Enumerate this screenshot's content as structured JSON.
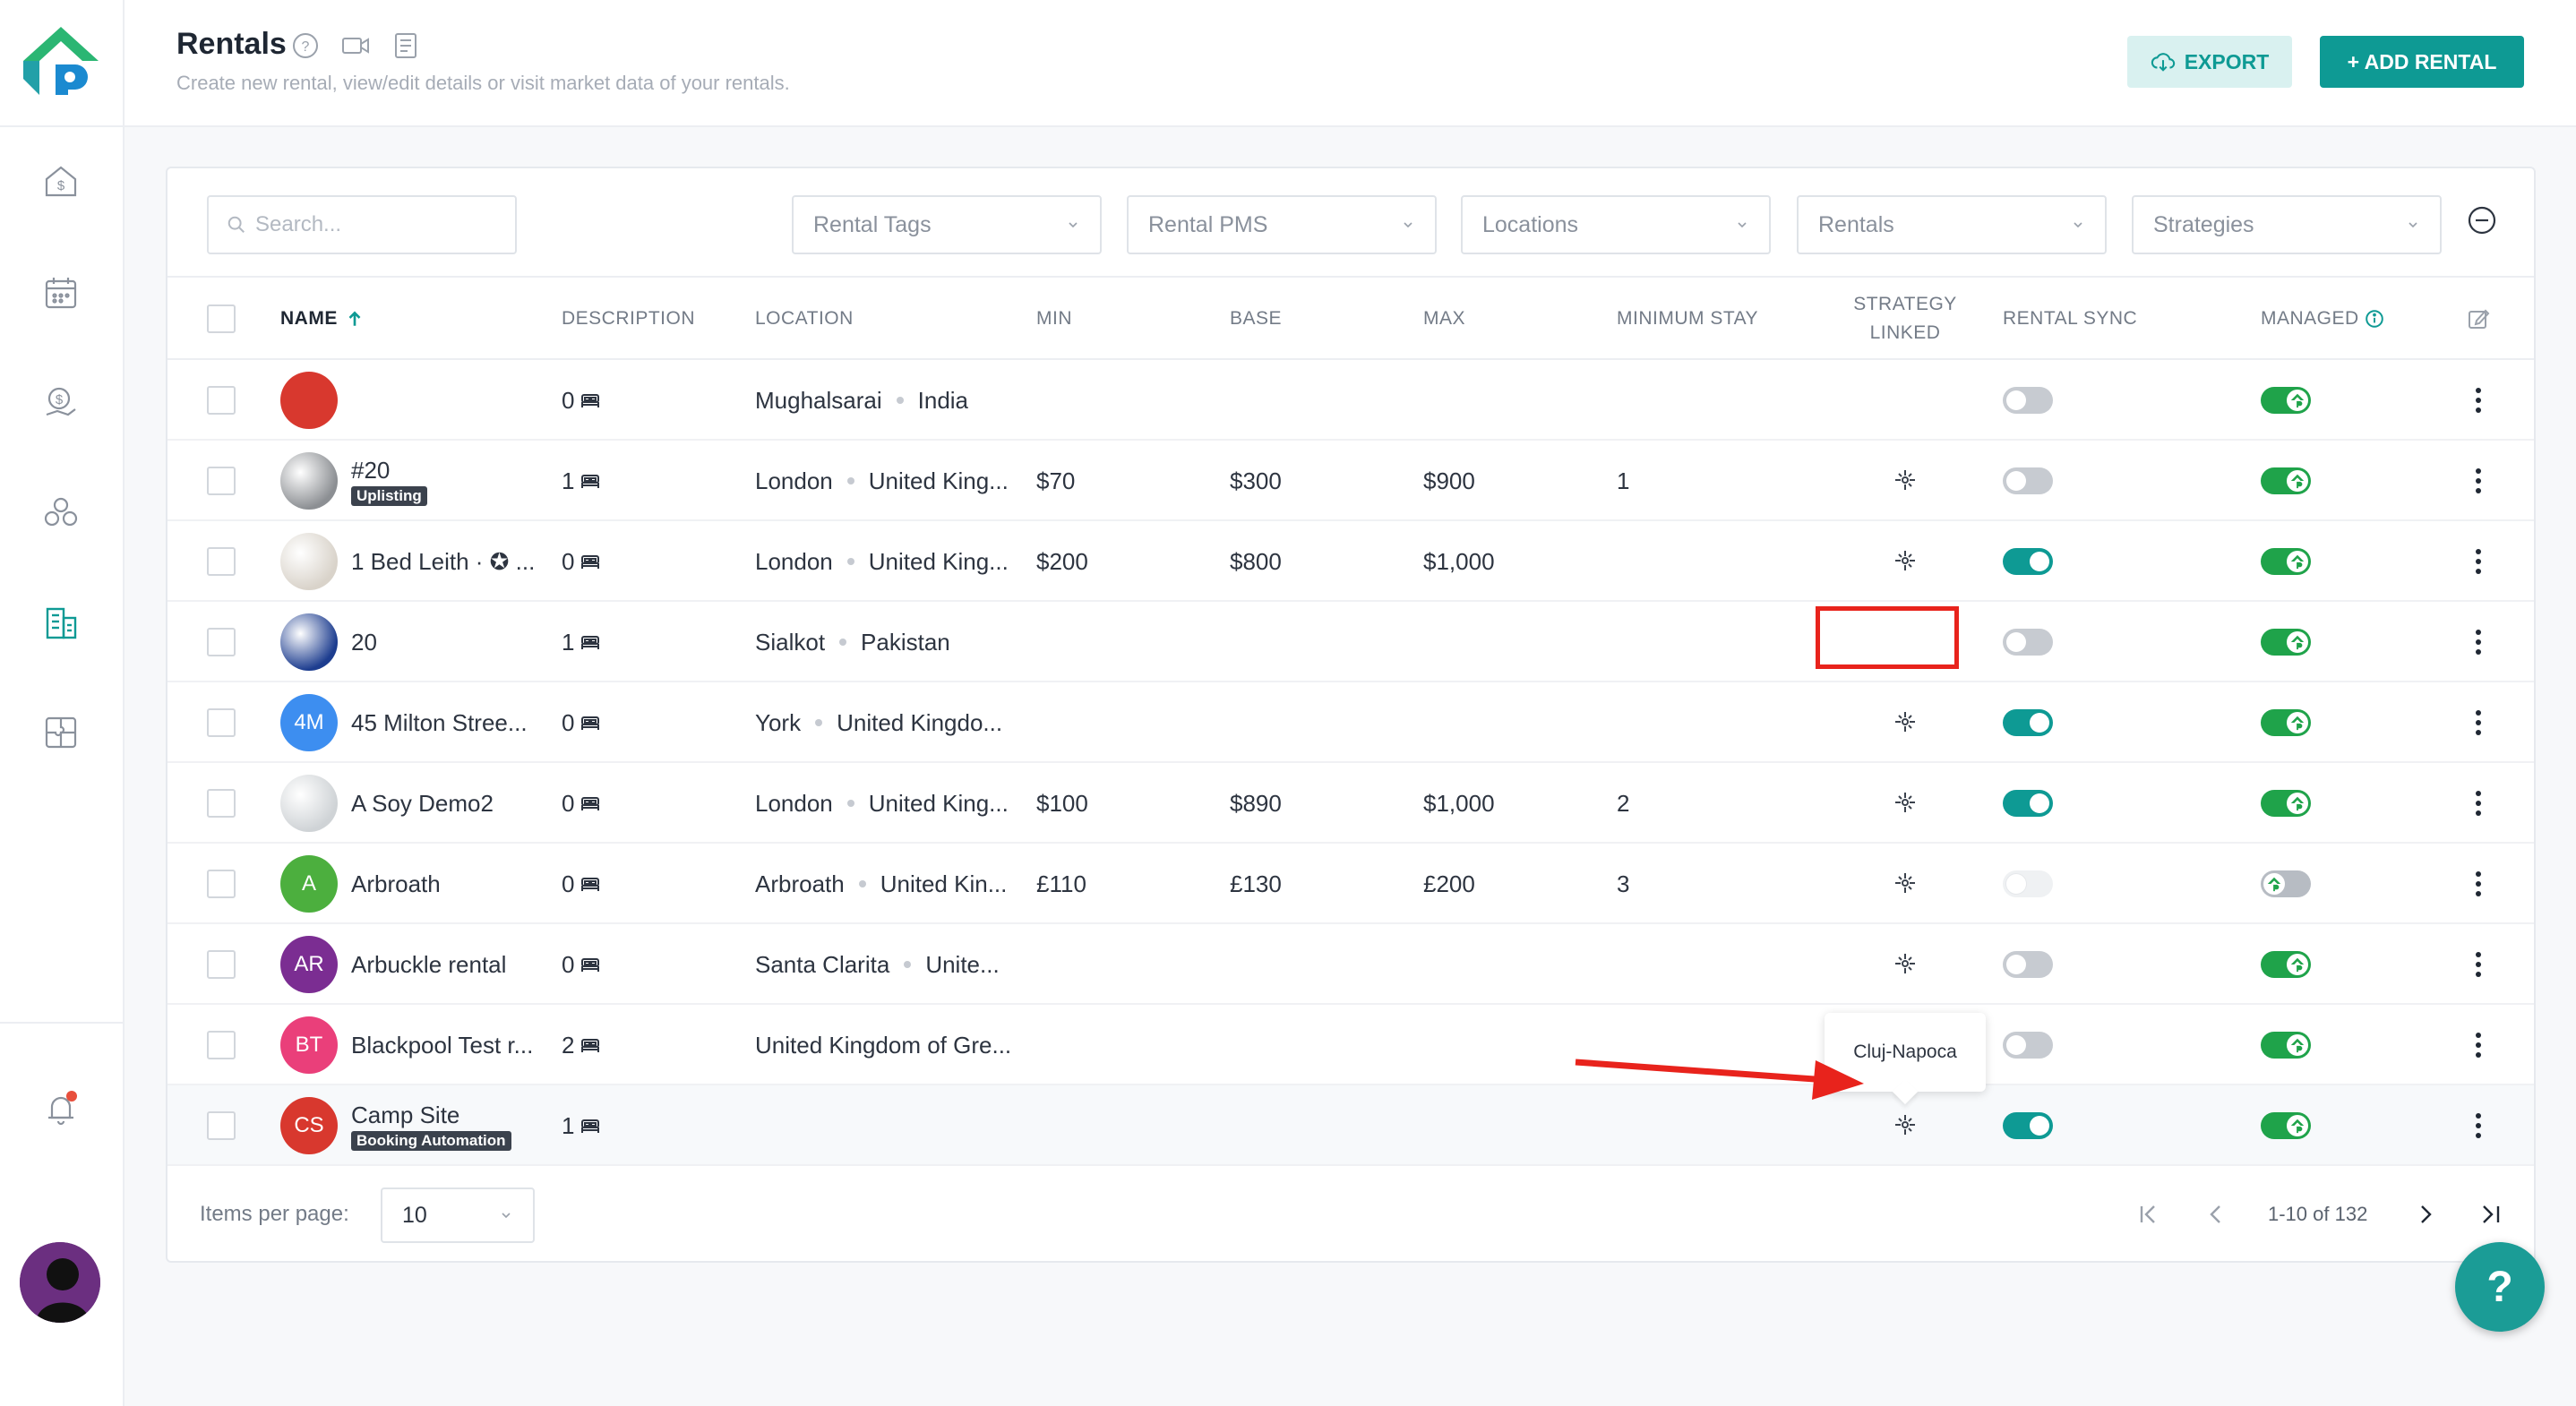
{
  "header": {
    "title": "Rentals",
    "subtitle": "Create new rental, view/edit details or visit market data of your rentals.",
    "export_label": "EXPORT",
    "add_label": "+ ADD RENTAL"
  },
  "sidebar": {
    "items": [
      "dashboard-icon",
      "calendar-icon",
      "pricing-icon",
      "market-icon",
      "rentals-icon",
      "puzzle-icon"
    ],
    "active": "rentals-icon"
  },
  "filters": {
    "search_placeholder": "Search...",
    "dropdowns": [
      "Rental Tags",
      "Rental PMS",
      "Locations",
      "Rentals",
      "Strategies"
    ]
  },
  "columns": {
    "name": "NAME",
    "description": "DESCRIPTION",
    "location": "LOCATION",
    "min": "MIN",
    "base": "BASE",
    "max": "MAX",
    "minimum_stay": "MINIMUM STAY",
    "strategy_linked_1": "STRATEGY",
    "strategy_linked_2": "LINKED",
    "rental_sync": "RENTAL SYNC",
    "managed": "MANAGED"
  },
  "rows": [
    {
      "name": "",
      "tag": "",
      "initials": "",
      "avatar_color": "#d8382e",
      "bedrooms": "0",
      "city": "Mughalsarai",
      "country": "India",
      "min": "",
      "base": "",
      "max": "",
      "min_stay": "",
      "strategy": false,
      "sync": "off",
      "managed": "on"
    },
    {
      "name": "#20",
      "tag": "Uplisting",
      "initials": "",
      "avatar_color": "#8c8f93",
      "bedrooms": "1",
      "city": "London",
      "country": "United King...",
      "min": "$70",
      "base": "$300",
      "max": "$900",
      "min_stay": "1",
      "strategy": true,
      "sync": "off",
      "managed": "on"
    },
    {
      "name": "1 Bed Leith · ✪ ...",
      "tag": "",
      "initials": "",
      "avatar_color": "#d9d3ca",
      "bedrooms": "0",
      "city": "London",
      "country": "United King...",
      "min": "$200",
      "base": "$800",
      "max": "$1,000",
      "min_stay": "",
      "strategy": true,
      "sync": "on",
      "managed": "on"
    },
    {
      "name": "20",
      "tag": "",
      "initials": "",
      "avatar_color": "#1d3d8f",
      "bedrooms": "1",
      "city": "Sialkot",
      "country": "Pakistan",
      "min": "",
      "base": "",
      "max": "",
      "min_stay": "",
      "strategy": false,
      "sync": "off",
      "managed": "on"
    },
    {
      "name": "45 Milton Stree...",
      "tag": "",
      "initials": "4M",
      "avatar_color": "#3d8ef0",
      "bedrooms": "0",
      "city": "York",
      "country": "United Kingdo...",
      "min": "",
      "base": "",
      "max": "",
      "min_stay": "",
      "strategy": true,
      "sync": "on",
      "managed": "on"
    },
    {
      "name": "A Soy Demo2",
      "tag": "",
      "initials": "",
      "avatar_color": "#cfd3d6",
      "bedrooms": "0",
      "city": "London",
      "country": "United King...",
      "min": "$100",
      "base": "$890",
      "max": "$1,000",
      "min_stay": "2",
      "strategy": true,
      "sync": "on",
      "managed": "on"
    },
    {
      "name": "Arbroath",
      "tag": "",
      "initials": "A",
      "avatar_color": "#4caf3e",
      "bedrooms": "0",
      "city": "Arbroath",
      "country": "United Kin...",
      "min": "£110",
      "base": "£130",
      "max": "£200",
      "min_stay": "3",
      "strategy": true,
      "sync": "disabled",
      "managed": "off"
    },
    {
      "name": "Arbuckle rental",
      "tag": "",
      "initials": "AR",
      "avatar_color": "#7b2d92",
      "bedrooms": "0",
      "city": "Santa Clarita",
      "country": "Unite...",
      "min": "",
      "base": "",
      "max": "",
      "min_stay": "",
      "strategy": true,
      "sync": "off",
      "managed": "on"
    },
    {
      "name": "Blackpool Test r...",
      "tag": "",
      "initials": "BT",
      "avatar_color": "#ea3f7a",
      "bedrooms": "2",
      "city": "United Kingdom of Gre...",
      "country": "",
      "min": "",
      "base": "",
      "max": "",
      "min_stay": "",
      "strategy": false,
      "sync": "off",
      "managed": "on"
    },
    {
      "name": "Camp Site",
      "tag": "Booking Automation",
      "initials": "CS",
      "avatar_color": "#d8382e",
      "bedrooms": "1",
      "city": "",
      "country": "",
      "min": "",
      "base": "",
      "max": "",
      "min_stay": "",
      "strategy": true,
      "sync": "on",
      "managed": "on"
    }
  ],
  "tooltip": {
    "text": "Cluj-Napoca"
  },
  "footer": {
    "items_per_page_label": "Items per page:",
    "items_per_page_value": "10",
    "range": "1-10 of 132"
  },
  "help": {
    "label": "?"
  },
  "colors": {
    "accent": "#0e9a94",
    "managed": "#1fa34a",
    "annotation": "#e8231c"
  }
}
